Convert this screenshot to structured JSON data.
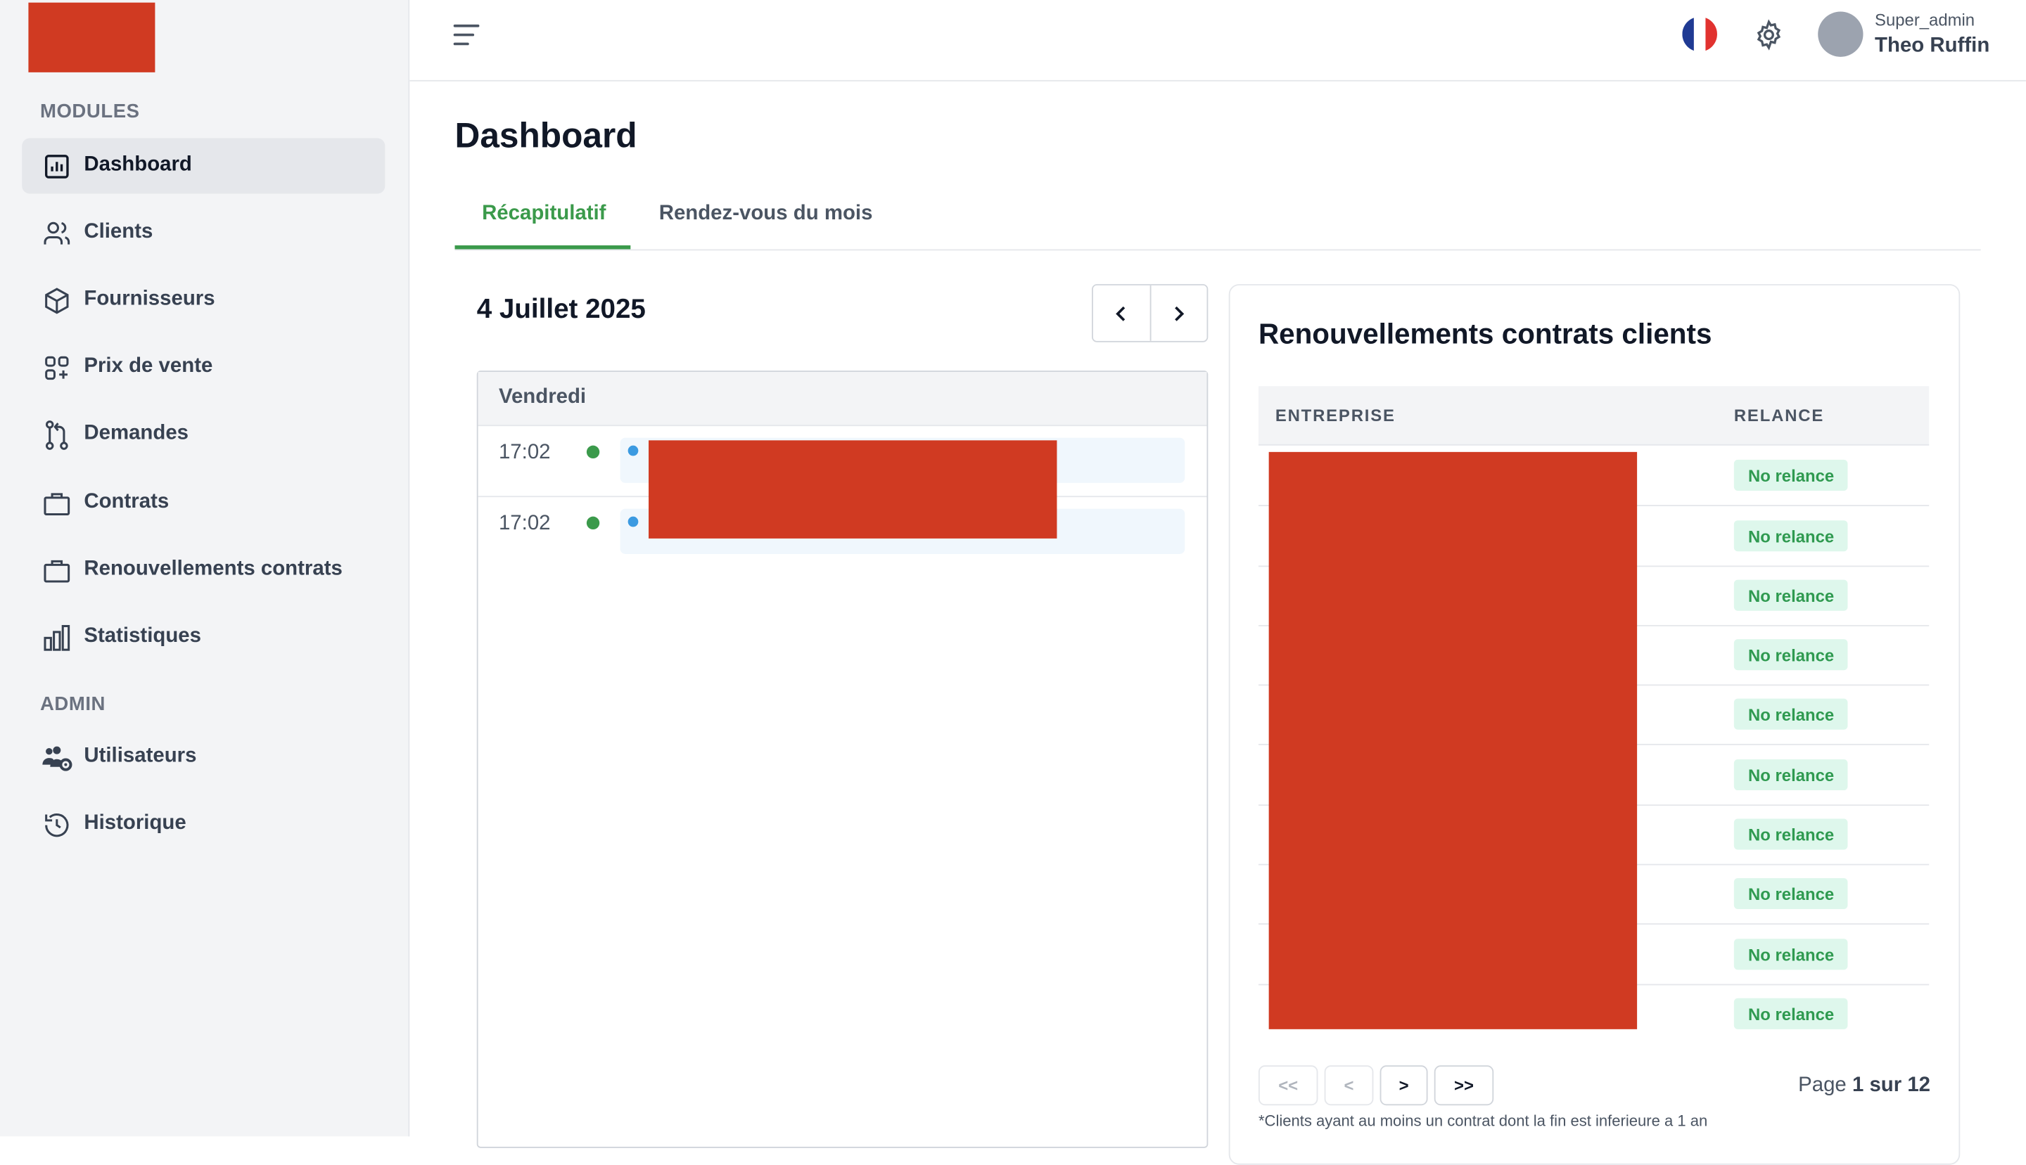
{
  "sidebar": {
    "modules_label": "MODULES",
    "admin_label": "ADMIN",
    "items": [
      {
        "label": "Dashboard",
        "icon": "chart-bar-icon",
        "active": true
      },
      {
        "label": "Clients",
        "icon": "users-icon"
      },
      {
        "label": "Fournisseurs",
        "icon": "cube-icon"
      },
      {
        "label": "Prix de vente",
        "icon": "squares-plus-icon"
      },
      {
        "label": "Demandes",
        "icon": "git-pull-request-icon"
      },
      {
        "label": "Contrats",
        "icon": "briefcase-icon"
      },
      {
        "label": "Renouvellements contrats",
        "icon": "briefcase-icon"
      },
      {
        "label": "Statistiques",
        "icon": "bar-chart-icon"
      }
    ],
    "admin_items": [
      {
        "label": "Utilisateurs",
        "icon": "users-cog-icon"
      },
      {
        "label": "Historique",
        "icon": "history-icon"
      }
    ]
  },
  "header": {
    "user_role": "Super_admin",
    "user_name": "Theo Ruffin",
    "flag_colors": [
      "#1f3a93",
      "#ffffff",
      "#e1322f"
    ]
  },
  "page": {
    "title": "Dashboard",
    "tabs": [
      {
        "label": "Récapitulatif",
        "active": true
      },
      {
        "label": "Rendez-vous du mois",
        "active": false
      }
    ]
  },
  "calendar": {
    "date": "4 Juillet 2025",
    "day": "Vendredi",
    "events": [
      {
        "time": "17:02"
      },
      {
        "time": "17:02"
      }
    ]
  },
  "renewals": {
    "title": "Renouvellements contrats clients",
    "columns": [
      "ENTREPRISE",
      "RELANCE"
    ],
    "rows": [
      {
        "relance": "No relance"
      },
      {
        "relance": "No relance"
      },
      {
        "relance": "No relance"
      },
      {
        "relance": "No relance"
      },
      {
        "relance": "No relance"
      },
      {
        "relance": "No relance"
      },
      {
        "relance": "No relance"
      },
      {
        "relance": "No relance"
      },
      {
        "relance": "No relance"
      },
      {
        "relance": "No relance"
      }
    ],
    "pager": {
      "first": "<<",
      "prev": "<",
      "next": ">",
      "last": ">>",
      "page_prefix": "Page ",
      "page_value": "1 sur 12"
    },
    "footnote": "*Clients ayant au moins un contrat dont la fin est inferieure a 1 an"
  },
  "colors": {
    "accent": "#3b9a4b",
    "redaction": "#d03a22",
    "badge_bg": "#def7ec"
  }
}
